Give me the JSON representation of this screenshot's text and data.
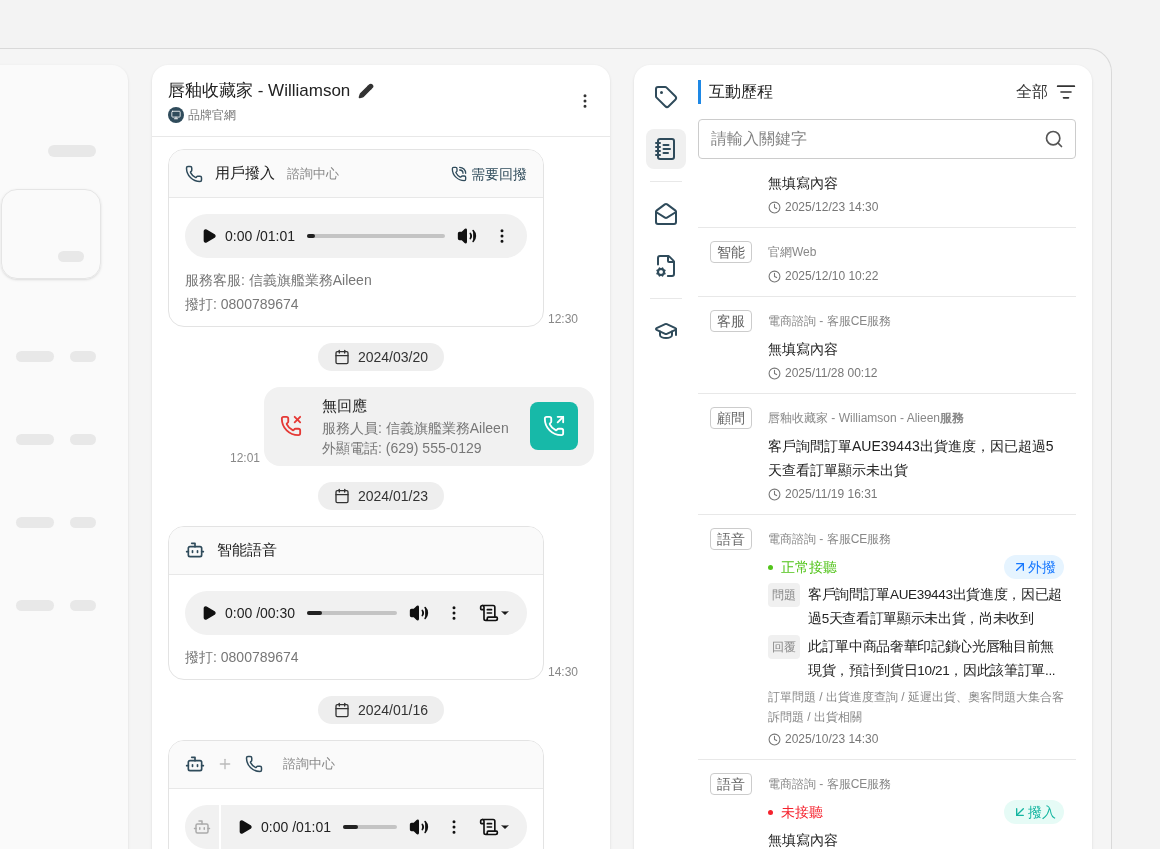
{
  "header": {
    "title": "唇釉收藏家 - Williamson",
    "source": "品牌官網"
  },
  "chat": [
    {
      "kind": "user_call_card",
      "title": "用戶撥入",
      "subtitle": "諮詢中心",
      "flag": "需要回撥",
      "audio": {
        "time": "0:00 /01:01",
        "level": 0.06,
        "transcript": false,
        "bot_prefix": false
      },
      "lines": [
        "服務客服: 信義旗艦業務Aileen",
        "撥打: 0800789674"
      ],
      "time": "12:30"
    },
    {
      "kind": "date",
      "text": "2024/03/20"
    },
    {
      "kind": "call",
      "title": "無回應",
      "lines": [
        "服務人員: 信義旗艦業務Aileen",
        "外顯電話: (629) 555-0129"
      ],
      "time": "12:01"
    },
    {
      "kind": "date",
      "text": "2024/01/23"
    },
    {
      "kind": "bot_card",
      "title": "智能語音",
      "audio": {
        "time": "0:00 /00:30",
        "level": 0.17,
        "transcript": true,
        "bot_prefix": false
      },
      "lines": [
        "撥打: 0800789674"
      ],
      "time": "14:30"
    },
    {
      "kind": "date",
      "text": "2024/01/16"
    },
    {
      "kind": "bot_call_card",
      "subtitle": "諮詢中心",
      "audio": {
        "time": "0:00 /01:01",
        "level": 0.28,
        "transcript": true,
        "bot_prefix": true
      }
    }
  ],
  "nav": [
    {
      "kind": "tag",
      "selected": false
    },
    {
      "kind": "notebook",
      "selected": true
    },
    {
      "kind": "mail",
      "selected": false
    },
    {
      "kind": "settings",
      "selected": false
    },
    {
      "kind": "school",
      "selected": false
    }
  ],
  "history_title": "互動歷程",
  "filter": "全部",
  "search": {
    "placeholder": "請輸入關鍵字"
  },
  "history": [
    {
      "content": "無填寫內容",
      "time": "2025/12/23 14:30"
    },
    {
      "tag": "智能",
      "source": "官網Web",
      "time": "2025/12/10 10:22"
    },
    {
      "tag": "客服",
      "source": "電商諮詢 - 客服CE服務",
      "content": "無填寫內容",
      "time": "2025/11/28 00:12"
    },
    {
      "tag": "顧問",
      "source": "唇釉收藏家 - Williamson - Alieen**服務**",
      "content": "客戶詢問訂單AUE39443出貨進度，因已超過5天查看訂單顯示未出貨",
      "time": "2025/11/19 16:31"
    },
    {
      "tag": "語音",
      "source": "電商諮詢 - 客服CE服務",
      "status": {
        "text": "正常接聽",
        "kind": "ok"
      },
      "direction": {
        "text": "外撥",
        "kind": "out"
      },
      "qa": [
        {
          "label": "問題",
          "text": "客戶詢問訂單AUE39443出貨進度，因已超過5天查看訂單顯示未出貨，尚未收到"
        },
        {
          "label": "回覆",
          "text": "此訂單中商品奢華印記鎖心光唇釉目前無現貨，預計到貨日10/21，因此該筆訂單..."
        }
      ],
      "categories": "訂單問題 / 出貨進度查詢 / 延遲出貨、奧客問題大集合客訴問題 / 出貨相關",
      "time": "2025/10/23 14:30"
    },
    {
      "tag": "語音",
      "source": "電商諮詢 - 客服CE服務",
      "status": {
        "text": "未接聽",
        "kind": "missed"
      },
      "direction": {
        "text": "撥入",
        "kind": "in"
      },
      "content": "無填寫內容"
    }
  ]
}
